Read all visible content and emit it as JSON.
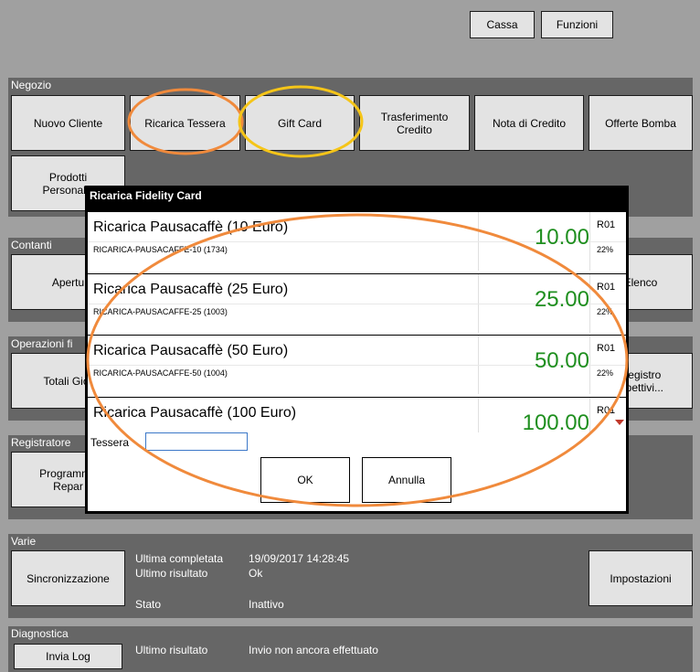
{
  "topbar": {
    "cassa": "Cassa",
    "funzioni": "Funzioni"
  },
  "negozio": {
    "title": "Negozio",
    "buttons": [
      "Nuovo Cliente",
      "Ricarica Tessera",
      "Gift Card",
      "Trasferimento\nCredito",
      "Nota di Credito",
      "Offerte Bomba"
    ],
    "prodotti": "Prodotti\nPersonaliz"
  },
  "contanti": {
    "title": "Contanti",
    "apertura": "Apertu",
    "elenco": "Elenco"
  },
  "operazioni": {
    "title": "Operazioni fi",
    "totali": "Totali Gior",
    "registro": "Registro\nispettivi..."
  },
  "registratore": {
    "title": "Registratore",
    "programma": "Programma\nRepar"
  },
  "varie": {
    "title": "Varie",
    "sincronizzazione": "Sincronizzazione",
    "impostazioni": "Impostazioni",
    "ultima_label": "Ultima completata",
    "ultima_value": "19/09/2017 14:28:45",
    "risultato_label": "Ultimo risultato",
    "risultato_value": "Ok",
    "stato_label": "Stato",
    "stato_value": "Inattivo"
  },
  "diagnostica": {
    "title": "Diagnostica",
    "invia": "Invia Log",
    "risultato_label": "Ultimo risultato",
    "risultato_value": "Invio non ancora effettuato"
  },
  "dialog": {
    "title": "Ricarica Fidelity Card",
    "items": [
      {
        "name": "Ricarica Pausacaffè  (10 Euro)",
        "code": "RICARICA-PAUSACAFFE-10  (1734)",
        "price": "10.00",
        "rep": "R01",
        "vat": "22%"
      },
      {
        "name": "Ricarica Pausacaffè  (25 Euro)",
        "code": "RICARICA-PAUSACAFFE-25  (1003)",
        "price": "25.00",
        "rep": "R01",
        "vat": "22%"
      },
      {
        "name": "Ricarica Pausacaffè  (50 Euro)",
        "code": "RICARICA-PAUSACAFFE-50  (1004)",
        "price": "50.00",
        "rep": "R01",
        "vat": "22%"
      },
      {
        "name": "Ricarica Pausacaffè  (100 Euro)",
        "code": "",
        "price": "100.00",
        "rep": "R01",
        "vat": ""
      }
    ],
    "tessera_label": "Tessera",
    "tessera_value": "",
    "ok": "OK",
    "annulla": "Annulla"
  },
  "colors": {
    "highlight_orange": "#f08a3c",
    "highlight_yellow": "#f5c518",
    "price_green": "#1f8f1f"
  }
}
